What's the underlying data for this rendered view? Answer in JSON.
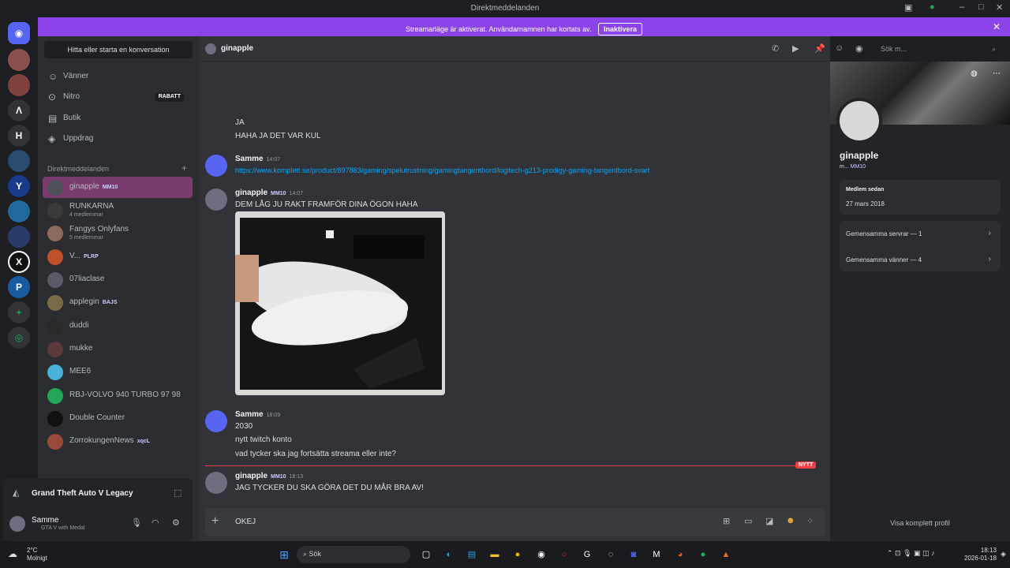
{
  "window": {
    "title": "Direktmeddelanden"
  },
  "banner": {
    "text": "Streamarläge är aktiverat. Användarnamnen har kortats av.",
    "button": "Inaktivera"
  },
  "sidebar": {
    "search_label": "Hitta eller starta en konversation",
    "nav": [
      {
        "label": "Vänner",
        "icon": "friends-icon"
      },
      {
        "label": "Nitro",
        "icon": "nitro-icon",
        "badge": "RABATT"
      },
      {
        "label": "Butik",
        "icon": "shop-icon"
      },
      {
        "label": "Uppdrag",
        "icon": "quests-icon"
      }
    ],
    "dm_header": "Direktmeddelanden",
    "dms": [
      {
        "name": "ginapple",
        "tag": "MM10",
        "active": true
      },
      {
        "name": "RUNKARNA",
        "sub": "4 medlemmar"
      },
      {
        "name": "Fangys Onlyfans",
        "sub": "5 medlemmar"
      },
      {
        "name": "V...",
        "tag": "PLRP"
      },
      {
        "name": "07liaclase"
      },
      {
        "name": "applegin",
        "tag": "BAJS"
      },
      {
        "name": "duddi"
      },
      {
        "name": "mukke"
      },
      {
        "name": "MEE6"
      },
      {
        "name": "RBJ-VOLVO 940 TURBO 97 98"
      },
      {
        "name": "Double Counter"
      },
      {
        "name": "ZorrokungenNews",
        "tag": "xqcL"
      }
    ]
  },
  "user_panel": {
    "game": "Grand Theft Auto V Legacy",
    "username": "Samme",
    "status": "GTA V with Medal"
  },
  "chat": {
    "header_name": "ginapple",
    "search_placeholder": "Sök m...",
    "messages": [
      {
        "lines": [
          "JA",
          "HAHA JA DET VAR KUL"
        ]
      },
      {
        "author": "Samme",
        "time": "14:07",
        "link": "https://www.komplett.se/product/897883/gaming/spelutrustning/gamingtangentbord/logitech-g213-prodigy-gaming-tangentbord-svart"
      },
      {
        "author": "ginapple",
        "badge": "MM10",
        "time": "14:07",
        "lines": [
          "DEM LÅG JU RAKT FRAMFÖR DINA ÖGON HAHA"
        ]
      },
      {
        "author": "Samme",
        "time": "18:09",
        "lines": [
          "2030",
          "nytt twitch konto",
          "vad tycker ska jag fortsätta streama eller inte?"
        ]
      },
      {
        "author": "ginapple",
        "badge": "MM10",
        "time": "18:13",
        "lines": [
          "JAG TYCKER DU SKA GÖRA DET DU MÅR BRA AV!"
        ]
      }
    ],
    "new_label": "NYTT",
    "composer_value": "OKEJ"
  },
  "profile": {
    "name": "ginapple",
    "sub": "m...",
    "badge": "MM10",
    "member_since_label": "Medlem sedan",
    "member_since": "27 mars 2018",
    "mutual_servers": "Gemensamma servrar — 1",
    "mutual_friends": "Gemensamma vänner — 4",
    "full_profile": "Visa komplett profil"
  },
  "taskbar": {
    "temp": "2°C",
    "weather": "Molnigt",
    "search": "Sök",
    "time": "18:13",
    "date": "2026-01-18"
  },
  "colors": {
    "accent": "#8c44e8",
    "link": "#00a8fc",
    "new": "#f23f43"
  }
}
